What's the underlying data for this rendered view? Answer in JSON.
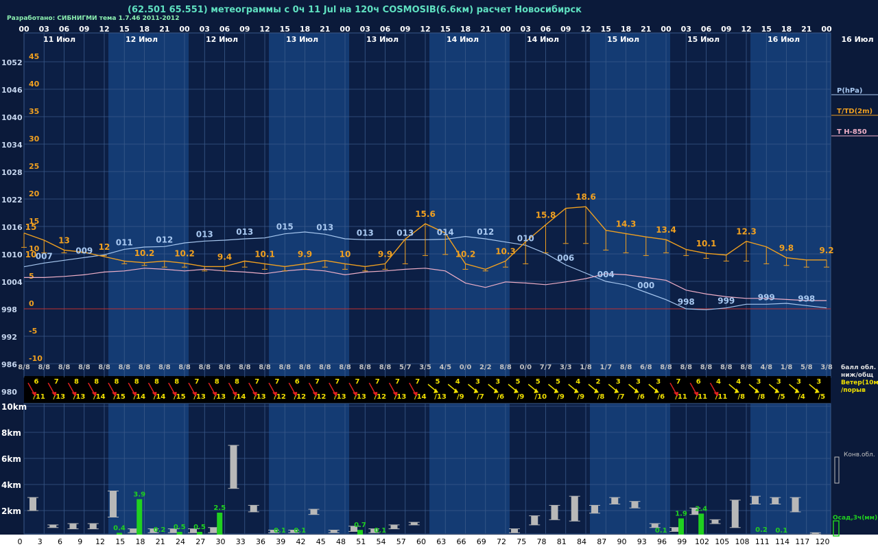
{
  "header": {
    "title": "(62.501 65.551) метеограммы с  0ч 11 Jul на 120ч COSMOSIB(6.6км) расчет Новосибирск",
    "developer": "Разработано: СИБНИГМИ тема 1.7.46 2011-2012"
  },
  "colors": {
    "background": "#0b1a3a",
    "band_light": "#143b73",
    "band_dark": "#0c1f45",
    "grid": "#3a5a8a",
    "pressure": "#a8c8f0",
    "temperature": "#f0a020",
    "t850": "#f0b0c8",
    "wind_red": "#e02020",
    "wind_yellow": "#f0e000",
    "precip": "#20d020",
    "cloud": "#b8b8b8"
  },
  "chart_data": [
    {
      "type": "line",
      "x_hours": [
        0,
        3,
        6,
        9,
        12,
        15,
        18,
        21,
        24,
        27,
        30,
        33,
        36,
        39,
        42,
        45,
        48,
        51,
        54,
        57,
        60,
        63,
        66,
        69,
        72,
        75,
        78,
        81,
        84,
        87,
        90,
        93,
        96,
        99,
        102,
        105,
        108,
        111,
        114,
        117,
        120
      ],
      "hour_labels": [
        "00",
        "03",
        "06",
        "09",
        "12",
        "15",
        "18",
        "21",
        "00",
        "03",
        "06",
        "09",
        "12",
        "15",
        "18",
        "21",
        "00",
        "03",
        "06",
        "09",
        "12",
        "15",
        "18",
        "21",
        "00",
        "03",
        "06",
        "09",
        "12",
        "15",
        "18",
        "21",
        "00",
        "03",
        "06",
        "09",
        "12",
        "15",
        "18",
        "21",
        "00"
      ],
      "date_labels": [
        "11 Июл",
        "12 Июл",
        "12 Июл",
        "13 Июл",
        "13 Июл",
        "14 Июл",
        "14 Июл",
        "15 Июл",
        "15 Июл",
        "16 Июл",
        "16 Июл"
      ],
      "pressure_ticks": [
        "1052",
        "1046",
        "1040",
        "1034",
        "1028",
        "1022",
        "1016",
        "1010",
        "1004",
        "998",
        "992",
        "986",
        "980"
      ],
      "temp_ticks": [
        "45",
        "40",
        "35",
        "30",
        "25",
        "20",
        "15",
        "10",
        "5",
        "0",
        "-5",
        "-10"
      ],
      "ylim_temp": [
        -10,
        50
      ],
      "ylim_pressure": [
        980,
        1052
      ],
      "series": [
        {
          "name": "P(hPa)",
          "values": [
            1007.2,
            1008.0,
            1008.6,
            1009.2,
            1009.8,
            1011.0,
            1011.5,
            1011.6,
            1012.4,
            1012.8,
            1013.0,
            1013.3,
            1013.5,
            1014.4,
            1014.8,
            1014.3,
            1013.3,
            1013.1,
            1013.1,
            1013.1,
            1013.1,
            1013.2,
            1013.8,
            1013.3,
            1012.6,
            1011.9,
            1010.1,
            1007.6,
            1005.8,
            1004.0,
            1003.2,
            1001.6,
            1000.0,
            998.0,
            997.8,
            998.2,
            999.0,
            999.0,
            999.2,
            998.7,
            998.2
          ]
        },
        {
          "name": "T/TD(2m)",
          "values": [
            13.8,
            12.5,
            10.7,
            10.3,
            9.5,
            8.7,
            8.4,
            8.7,
            8.3,
            7.7,
            7.7,
            8.7,
            8.2,
            7.7,
            8.2,
            8.8,
            8.2,
            7.7,
            8.2,
            12.7,
            15.5,
            13.8,
            8.2,
            7.2,
            8.7,
            12.2,
            15.3,
            18.3,
            18.6,
            14.3,
            13.7,
            13.1,
            12.6,
            10.8,
            10.1,
            9.8,
            12.3,
            11.3,
            9.3,
            8.9,
            8.9
          ]
        },
        {
          "name": "T H-850",
          "values": [
            5.7,
            5.7,
            5.9,
            6.2,
            6.7,
            6.9,
            7.4,
            7.2,
            6.9,
            7.2,
            6.9,
            6.7,
            6.4,
            6.9,
            7.2,
            6.9,
            6.2,
            6.7,
            6.9,
            7.2,
            7.4,
            6.9,
            4.7,
            3.9,
            4.9,
            4.7,
            4.4,
            4.9,
            5.5,
            6.4,
            6.2,
            5.7,
            5.2,
            3.4,
            2.7,
            2.2,
            1.9,
            1.9,
            1.7,
            1.5,
            1.5
          ]
        }
      ],
      "dewpoint_low": [
        11.2,
        10.2,
        10.2,
        10.2,
        9.7,
        8.2,
        7.9,
        7.6,
        7.6,
        6.9,
        6.9,
        7.6,
        7.2,
        6.9,
        7.2,
        7.6,
        7.2,
        6.9,
        7.2,
        8.2,
        9.7,
        9.9,
        7.2,
        6.9,
        7.6,
        8.2,
        10.2,
        11.9,
        11.9,
        10.7,
        10.2,
        9.7,
        10.2,
        9.7,
        9.2,
        8.7,
        8.7,
        8.2,
        7.9,
        7.6,
        7.6
      ],
      "pressure_labels": [
        {
          "i": 1,
          "t": "007"
        },
        {
          "i": 3,
          "t": "009"
        },
        {
          "i": 5,
          "t": "011"
        },
        {
          "i": 7,
          "t": "012"
        },
        {
          "i": 9,
          "t": "013"
        },
        {
          "i": 11,
          "t": "013"
        },
        {
          "i": 13,
          "t": "015"
        },
        {
          "i": 15,
          "t": "013"
        },
        {
          "i": 17,
          "t": "013"
        },
        {
          "i": 19,
          "t": "013"
        },
        {
          "i": 21,
          "t": "014"
        },
        {
          "i": 23,
          "t": "012"
        },
        {
          "i": 25,
          "t": "010"
        },
        {
          "i": 27,
          "t": "006"
        },
        {
          "i": 29,
          "t": "004"
        },
        {
          "i": 31,
          "t": "000"
        },
        {
          "i": 33,
          "t": "998"
        },
        {
          "i": 35,
          "t": "999"
        },
        {
          "i": 37,
          "t": "999"
        },
        {
          "i": 39,
          "t": "998"
        }
      ],
      "temp_labels": [
        {
          "i": 0,
          "t": "15"
        },
        {
          "i": 0,
          "t": "10"
        },
        {
          "i": 2,
          "t": "13"
        },
        {
          "i": 4,
          "t": "12"
        },
        {
          "i": 6,
          "t": "10.2"
        },
        {
          "i": 8,
          "t": "10.2"
        },
        {
          "i": 10,
          "t": "9.4"
        },
        {
          "i": 12,
          "t": "10.1"
        },
        {
          "i": 14,
          "t": "9.9"
        },
        {
          "i": 16,
          "t": "10"
        },
        {
          "i": 18,
          "t": "9.9"
        },
        {
          "i": 20,
          "t": "15.6"
        },
        {
          "i": 22,
          "t": "10.2"
        },
        {
          "i": 24,
          "t": "10.3"
        },
        {
          "i": 26,
          "t": "15.8"
        },
        {
          "i": 28,
          "t": "18.6"
        },
        {
          "i": 30,
          "t": "14.3"
        },
        {
          "i": 32,
          "t": "13.4"
        },
        {
          "i": 34,
          "t": "10.1"
        },
        {
          "i": 36,
          "t": "12.3"
        },
        {
          "i": 38,
          "t": "9.8"
        },
        {
          "i": 40,
          "t": "9.2"
        }
      ],
      "cloud_cover": [
        "8/8",
        "8/8",
        "8/8",
        "8/8",
        "8/8",
        "8/8",
        "8/8",
        "8/8",
        "8/8",
        "8/8",
        "8/8",
        "8/8",
        "8/8",
        "8/8",
        "8/8",
        "8/8",
        "8/8",
        "8/8",
        "8/8",
        "5/7",
        "3/5",
        "4/5",
        "0/0",
        "2/2",
        "8/8",
        "0/0",
        "7/7",
        "3/3",
        "1/8",
        "1/7",
        "8/8",
        "6/8",
        "8/8",
        "8/8",
        "8/8",
        "8/8",
        "8/8",
        "4/8",
        "1/8",
        "5/8",
        "3/8"
      ],
      "wind_speed": [
        "6",
        "7",
        "8",
        "8",
        "8",
        "8",
        "8",
        "8",
        "7",
        "8",
        "8",
        "7",
        "7",
        "6",
        "7",
        "7",
        "7",
        "7",
        "7",
        "7",
        "5",
        "4",
        "3",
        "3",
        "5",
        "5",
        "5",
        "4",
        "2",
        "3",
        "3",
        "3",
        "7",
        "6",
        "4",
        "4",
        "3",
        "3",
        "3",
        "3"
      ],
      "wind_gust": [
        "/11",
        "/13",
        "/13",
        "/14",
        "/15",
        "/14",
        "/14",
        "/15",
        "/13",
        "/13",
        "/14",
        "/13",
        "/12",
        "/12",
        "/12",
        "/13",
        "/13",
        "/12",
        "/13",
        "/14",
        "/13",
        "/9",
        "/7",
        "/6",
        "/9",
        "/10",
        "/9",
        "/9",
        "/8",
        "/7",
        "/6",
        "/6",
        "/11",
        "/11",
        "/11",
        "/8",
        "/8",
        "/5",
        "/4",
        "/5"
      ],
      "wind_color": [
        "red",
        "red",
        "red",
        "red",
        "red",
        "red",
        "red",
        "red",
        "red",
        "red",
        "red",
        "red",
        "red",
        "red",
        "red",
        "red",
        "red",
        "red",
        "red",
        "red",
        "yellow",
        "yellow",
        "yellow",
        "yellow",
        "yellow",
        "yellow",
        "yellow",
        "yellow",
        "yellow",
        "yellow",
        "yellow",
        "yellow",
        "red",
        "red",
        "red",
        "yellow",
        "yellow",
        "yellow",
        "yellow",
        "yellow"
      ],
      "legend": [
        "P(hPa)",
        "T/TD(2m)",
        "T H-850",
        "балл обл. ниж/общ",
        "Ветер(10м)",
        "/порыв"
      ]
    },
    {
      "type": "bar",
      "x_labels": [
        "0",
        "3",
        "6",
        "9",
        "12",
        "15",
        "18",
        "21",
        "24",
        "27",
        "30",
        "33",
        "36",
        "39",
        "42",
        "45",
        "48",
        "51",
        "54",
        "57",
        "60",
        "63",
        "66",
        "69",
        "72",
        "75",
        "78",
        "81",
        "84",
        "87",
        "90",
        "93",
        "96",
        "99",
        "102",
        "105",
        "108",
        "111",
        "114",
        "117",
        "120"
      ],
      "height_ticks": [
        "10km",
        "8km",
        "6km",
        "4km",
        "2km"
      ],
      "ylim_km": [
        0,
        10.5
      ],
      "cloud_km": [
        [
          2.0,
          3.0
        ],
        [
          0.7,
          0.9
        ],
        [
          0.6,
          1.0
        ],
        [
          0.6,
          1.0
        ],
        [
          1.5,
          3.5
        ],
        [
          0.3,
          0.6
        ],
        [
          0.3,
          0.6
        ],
        [
          0.3,
          0.6
        ],
        [
          0.3,
          0.6
        ],
        [
          0.3,
          0.7
        ],
        [
          3.7,
          7.0
        ],
        [
          1.9,
          2.4
        ],
        [
          0.3,
          0.5
        ],
        [
          0.3,
          0.5
        ],
        [
          1.7,
          2.1
        ],
        [
          0.3,
          0.5
        ],
        [
          0.4,
          0.8
        ],
        [
          0.3,
          0.6
        ],
        [
          0.6,
          0.9
        ],
        [
          0.9,
          1.1
        ],
        [
          0,
          0.05
        ],
        [
          0,
          0.05
        ],
        [
          0,
          0.05
        ],
        [
          0,
          0.05
        ],
        [
          0.3,
          0.6
        ],
        [
          0.9,
          1.6
        ],
        [
          1.3,
          2.4
        ],
        [
          1.2,
          3.1
        ],
        [
          1.8,
          2.4
        ],
        [
          2.5,
          3.0
        ],
        [
          2.2,
          2.7
        ],
        [
          0.7,
          1.0
        ],
        [
          0.4,
          0.7
        ],
        [
          1.7,
          2.2
        ],
        [
          1.0,
          1.3
        ],
        [
          0.7,
          2.8
        ],
        [
          2.5,
          3.1
        ],
        [
          2.5,
          3.0
        ],
        [
          1.9,
          3.0
        ],
        [
          0.2,
          0.3
        ]
      ],
      "precip_mm": [
        0,
        0,
        0,
        0,
        0.4,
        3.9,
        0.2,
        0.5,
        0.5,
        2.5,
        0,
        0,
        0.1,
        0.1,
        0,
        0,
        0.7,
        0.1,
        0,
        0,
        0,
        0,
        0,
        0,
        0,
        0,
        0,
        0,
        0,
        0,
        0,
        0.1,
        1.9,
        2.4,
        0,
        0,
        0.2,
        0.1,
        0,
        0
      ],
      "precip_labels": [
        {
          "i": 4,
          "t": "0.4"
        },
        {
          "i": 5,
          "t": "3.9"
        },
        {
          "i": 6,
          "t": "0.2"
        },
        {
          "i": 7,
          "t": "0.5"
        },
        {
          "i": 9,
          "t": "2.5"
        },
        {
          "i": 8,
          "t": "0.5"
        },
        {
          "i": 12,
          "t": "0.1"
        },
        {
          "i": 13,
          "t": "0.1"
        },
        {
          "i": 16,
          "t": "0.7"
        },
        {
          "i": 17,
          "t": "0.1"
        },
        {
          "i": 31,
          "t": "0.1"
        },
        {
          "i": 32,
          "t": "1.9"
        },
        {
          "i": 33,
          "t": "2.4"
        },
        {
          "i": 36,
          "t": "0.2"
        },
        {
          "i": 37,
          "t": "0.1"
        }
      ],
      "legend": [
        "Конв.обл.",
        "Осад,3ч(мм)"
      ]
    }
  ]
}
